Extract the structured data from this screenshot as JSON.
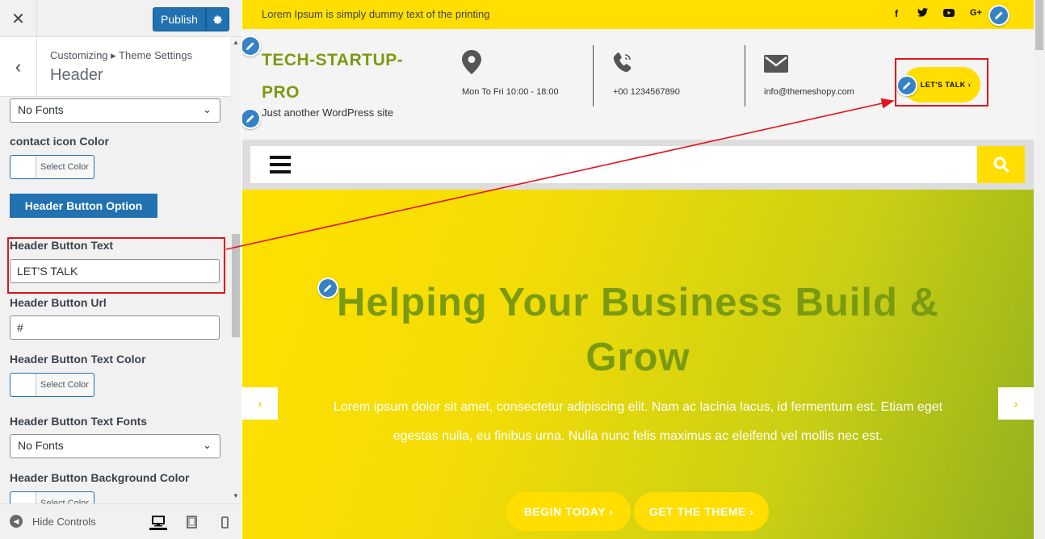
{
  "sidebar": {
    "publish_label": "Publish",
    "breadcrumb": "Customizing ▸ Theme Settings",
    "section_title": "Header",
    "fonts_select_1": "No Fonts",
    "contact_icon_color_label": "contact icon Color",
    "select_color": "Select Color",
    "header_button_option": "Header Button Option",
    "header_button_text_label": "Header Button Text",
    "header_button_text_value": "LET'S TALK",
    "header_button_url_label": "Header Button Url",
    "header_button_url_value": "#",
    "header_button_text_color_label": "Header Button Text Color",
    "header_button_text_fonts_label": "Header Button Text Fonts",
    "fonts_select_2": "No Fonts",
    "header_button_bg_color_label": "Header Button Background Color",
    "hide_controls": "Hide Controls"
  },
  "preview": {
    "tagline": "Lorem Ipsum is simply dummy text of the printing",
    "social_icons": [
      "facebook-icon",
      "twitter-icon",
      "youtube-icon",
      "google-plus-icon"
    ],
    "logo_line1": "TECH-STARTUP-",
    "logo_line2": "PRO",
    "site_description": "Just another WordPress site",
    "hours": "Mon To Fri 10:00 - 18:00",
    "phone": "+00 1234567890",
    "email": "info@themeshopy.com",
    "lets_talk": "LET'S TALK  ›",
    "hero_title": "Helping Your Business Build & Grow",
    "hero_text": "Lorem ipsum dolor sit amet, consectetur adipiscing elit. Nam ac lacinia lacus, id fermentum est. Etiam eget egestas nulla, eu finibus urna. Nulla nunc felis maximus ac eleifend vel mollis nec est.",
    "begin_today": "BEGIN TODAY ›",
    "get_theme": "GET THE THEME ›"
  },
  "colors": {
    "accent_yellow": "#ffde00",
    "logo_green": "#7d9a10",
    "wp_blue": "#2271b1",
    "highlight_red": "#e3121b"
  }
}
